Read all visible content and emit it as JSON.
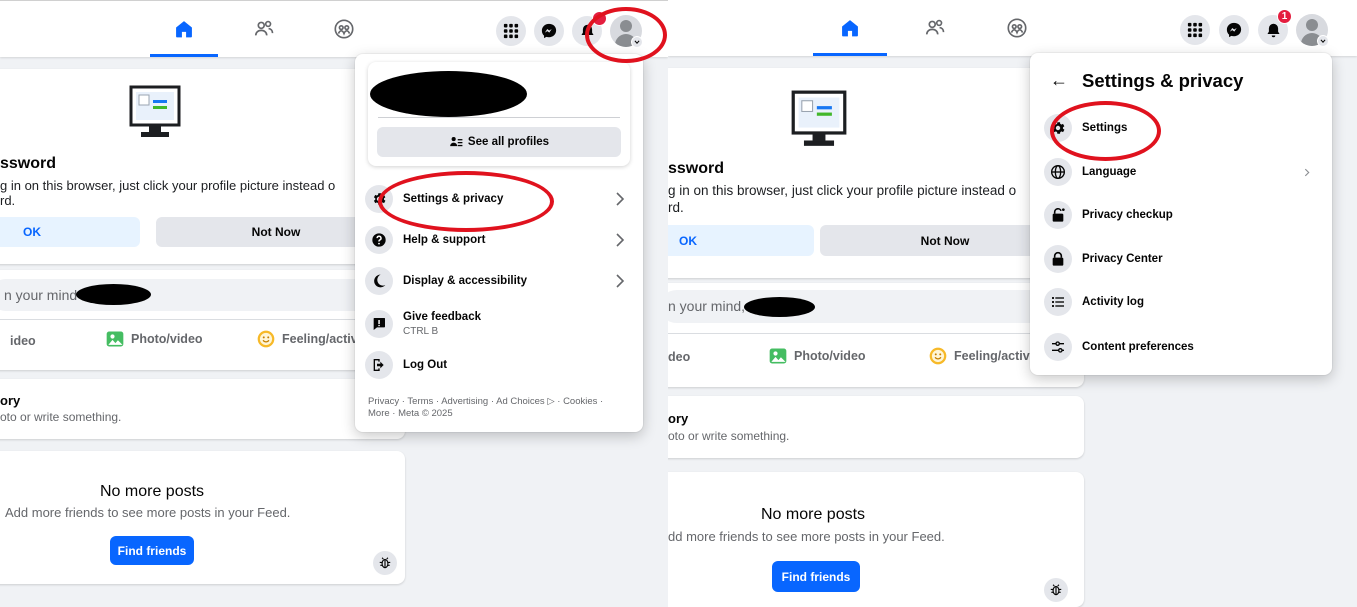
{
  "left_panel": {
    "save_login": {
      "heading": "ssword",
      "body_line1": "g in on this browser, just click your profile picture instead o",
      "body_line2": "rd.",
      "ok_label": "OK",
      "not_now_label": "Not Now"
    },
    "composer": {
      "prompt": "n your mind",
      "live_video_label": "ideo",
      "photo_video_label": "Photo/video",
      "feeling_label": "Feeling/activi"
    },
    "story": {
      "title": "ory",
      "subtitle": "oto or write something."
    },
    "feed_end": {
      "title": "No more posts",
      "subtitle": "Add more friends to see more posts in your Feed.",
      "find_friends_label": "Find friends"
    },
    "account_menu": {
      "see_all_profiles_label": "See all profiles",
      "items": [
        {
          "label": "Settings & privacy",
          "icon": "gear-icon"
        },
        {
          "label": "Help & support",
          "icon": "question-icon"
        },
        {
          "label": "Display & accessibility",
          "icon": "moon-icon"
        },
        {
          "label": "Give feedback",
          "sublabel": "CTRL B",
          "icon": "feedback-icon"
        },
        {
          "label": "Log Out",
          "icon": "logout-icon"
        }
      ],
      "footer_line1": "Privacy · Terms · Advertising · Ad Choices ▷ · Cookies ·",
      "footer_line2": "More · Meta © 2025"
    },
    "notification_badge": ""
  },
  "right_panel": {
    "save_login": {
      "heading": "ssword",
      "body_line1": "g in on this browser, just click your profile picture instead o",
      "body_line2": "rd.",
      "ok_label": "OK",
      "not_now_label": "Not Now"
    },
    "composer": {
      "prompt": "n your mind,",
      "live_video_label": "deo",
      "photo_video_label": "Photo/video",
      "feeling_label": "Feeling/activi"
    },
    "story": {
      "title": "ory",
      "subtitle": "oto or write something."
    },
    "feed_end": {
      "title": "No more posts",
      "subtitle": "dd more friends to see more posts in your Feed.",
      "find_friends_label": "Find friends"
    },
    "settings_menu": {
      "back_arrow": "←",
      "title": "Settings & privacy",
      "items": [
        {
          "label": "Settings",
          "icon": "gear-icon"
        },
        {
          "label": "Language",
          "icon": "globe-icon"
        },
        {
          "label": "Privacy checkup",
          "icon": "lock-icon"
        },
        {
          "label": "Privacy Center",
          "icon": "lock-icon"
        },
        {
          "label": "Activity log",
          "icon": "list-icon"
        },
        {
          "label": "Content preferences",
          "icon": "sliders-icon"
        }
      ]
    },
    "notification_badge": "1"
  },
  "colors": {
    "brand_blue": "#0866ff",
    "badge_red": "#e41e3f",
    "annotation_red": "#e0121e",
    "page_bg": "#f0f2f5"
  }
}
